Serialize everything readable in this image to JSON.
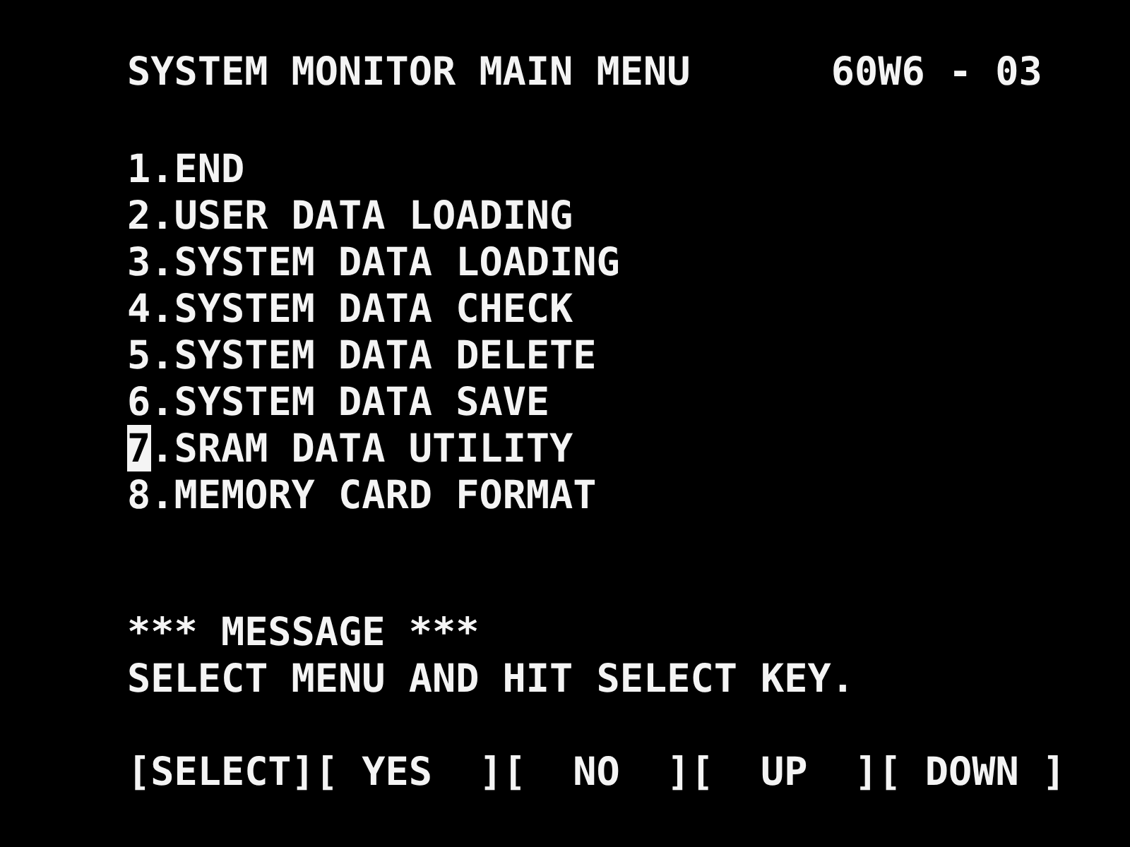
{
  "header": {
    "title": "SYSTEM MONITOR MAIN MENU",
    "code": "60W6 - 03"
  },
  "menu": [
    {
      "number": "1",
      "label": ".END",
      "selected": false
    },
    {
      "number": "2",
      "label": ".USER DATA LOADING",
      "selected": false
    },
    {
      "number": "3",
      "label": ".SYSTEM DATA LOADING",
      "selected": false
    },
    {
      "number": "4",
      "label": ".SYSTEM DATA CHECK",
      "selected": false
    },
    {
      "number": "5",
      "label": ".SYSTEM DATA DELETE",
      "selected": false
    },
    {
      "number": "6",
      "label": ".SYSTEM DATA SAVE",
      "selected": false
    },
    {
      "number": "7",
      "label": ".SRAM DATA UTILITY",
      "selected": true
    },
    {
      "number": "8",
      "label": ".MEMORY CARD FORMAT",
      "selected": false
    }
  ],
  "message": {
    "heading": "*** MESSAGE ***",
    "text": "SELECT MENU AND HIT SELECT KEY."
  },
  "keys": [
    "[SELECT]",
    "[ YES  ]",
    "[  NO  ]",
    "[  UP  ]",
    "[ DOWN ]"
  ]
}
